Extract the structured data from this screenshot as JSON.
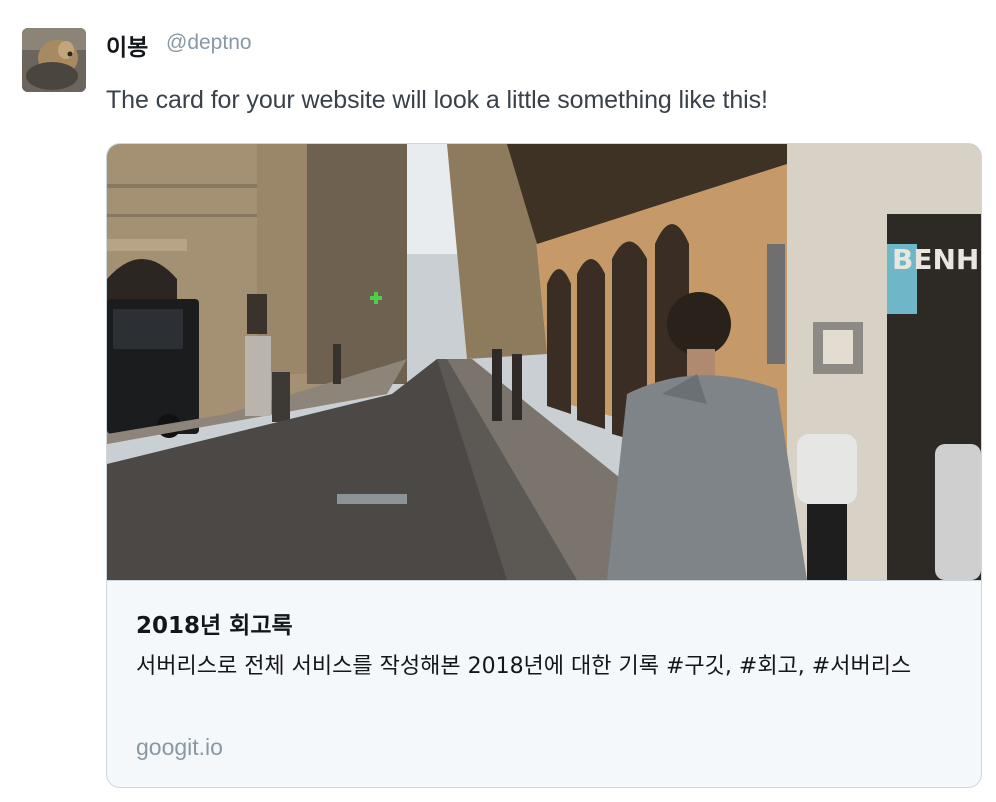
{
  "author": {
    "display_name": "이봉",
    "handle": "@deptno",
    "avatar_icon": "user-avatar"
  },
  "tweet": {
    "text": "The card for your website will look a little something like this!"
  },
  "card": {
    "image_sign_text": "BENH",
    "title": "2018년 회고록",
    "description": "서버리스로 전체 서비스를 작성해본 2018년에 대한 기록 #구깃, #회고, #서버리스",
    "domain": "googit.io"
  },
  "colors": {
    "text_primary": "#14171a",
    "text_secondary": "#8899a6",
    "card_border": "#ccd6dd",
    "card_background": "#f5f8fa"
  }
}
